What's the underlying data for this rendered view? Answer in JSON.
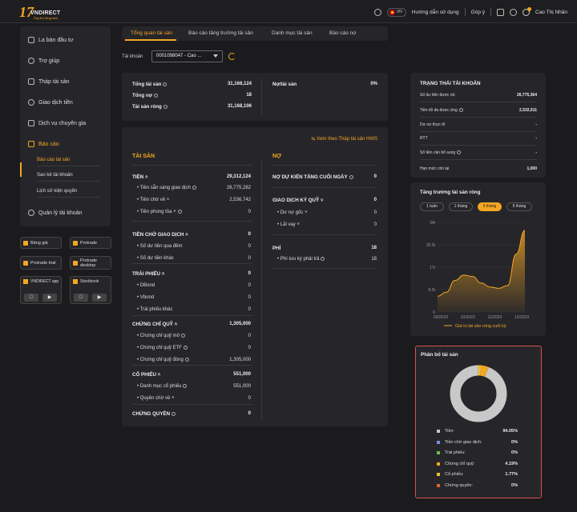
{
  "header": {
    "brand_mark": "17",
    "brand_name": "VNDIRECT",
    "brand_tag": "Ông thợ đồng hành",
    "lang": "VN",
    "help": "Hướng dẫn sử dụng",
    "feedback": "Góp ý",
    "user": "Cao Thị Nhân",
    "icons": [
      "gear-icon",
      "flag-icon",
      "mail-icon",
      "bell-icon",
      "user-icon"
    ]
  },
  "sidebar": {
    "items": [
      {
        "label": "La bàn đầu tư",
        "icon": "book-icon"
      },
      {
        "label": "Trợ giúp",
        "icon": "help-icon"
      },
      {
        "label": "Tháp tài sản",
        "icon": "pyramid-icon"
      },
      {
        "label": "Giao dịch tiền",
        "icon": "money-icon"
      },
      {
        "label": "Dịch vụ chuyên gia",
        "icon": "expert-icon"
      },
      {
        "label": "Báo cáo",
        "icon": "report-icon"
      }
    ],
    "sub_items": [
      "Báo cáo tài sản",
      "Sao kê tài khoản",
      "Lịch sử kiện quyền"
    ],
    "account_mgmt": "Quản lý tài khoản"
  },
  "apps": {
    "bang_gia": "Bảng giá",
    "protrade": "Protrade",
    "protrade_trial": "Protrade trial",
    "protrade_desktop": "Protrade desktop",
    "vndirect_app": "VNDIRECT app",
    "stockbook": "Stockbook"
  },
  "tabs": [
    "Tổng quan tài sản",
    "Báo cáo tăng trưởng tài sản",
    "Danh mục tài sản",
    "Báo cáo nợ"
  ],
  "account": {
    "label": "Tài khoản",
    "value": "0001098047 - Cao ..."
  },
  "summary": {
    "total_assets_label": "Tổng tài sản",
    "total_assets": "31,168,124",
    "total_debt_label": "Tổng nợ",
    "total_debt": "18",
    "net_assets_label": "Tài sản ròng",
    "net_assets": "31,168,106",
    "debt_ratio_label": "Nợ/tài sản",
    "debt_ratio": "0%"
  },
  "detail": {
    "link": "Xem theo Tháp tài sản HWS",
    "assets_header": "TÀI SẢN",
    "debt_header": "NỢ",
    "assets": [
      {
        "label": "TIỀN",
        "value": "29,312,124",
        "bold": true
      },
      {
        "label": "Tiền sẵn sàng giao dịch",
        "value": "26,775,282"
      },
      {
        "label": "Tiền chờ về",
        "value": "2,536,742"
      },
      {
        "label": "Tiền phong tỏa",
        "value": "0"
      },
      {
        "label": "TIỀN CHỜ GIAO DỊCH",
        "value": "0",
        "bold": true
      },
      {
        "label": "Số dư tiền qua đêm",
        "value": "0"
      },
      {
        "label": "Số dư tiền khác",
        "value": "0"
      },
      {
        "label": "TRÁI PHIẾU",
        "value": "0",
        "bold": true
      },
      {
        "label": "DBond",
        "value": "0"
      },
      {
        "label": "Vbond",
        "value": "0"
      },
      {
        "label": "Trái phiếu khác",
        "value": "0"
      },
      {
        "label": "CHỨNG CHỈ QUỸ",
        "value": "1,305,000",
        "bold": true
      },
      {
        "label": "Chứng chỉ quỹ mở",
        "value": "0"
      },
      {
        "label": "Chứng chỉ quỹ ETF",
        "value": "0"
      },
      {
        "label": "Chứng chỉ quỹ đóng",
        "value": "1,305,000"
      },
      {
        "label": "CỔ PHIẾU",
        "value": "551,000",
        "bold": true
      },
      {
        "label": "Danh mục cổ phiếu",
        "value": "551,000"
      },
      {
        "label": "Quyền chờ về",
        "value": "0"
      },
      {
        "label": "CHỨNG QUYỀN",
        "value": "0",
        "bold": true
      }
    ],
    "debts": [
      {
        "label": "NỢ DỰ KIẾN TẤNG CUỐI NGÀY",
        "value": "0",
        "bold": true
      },
      {
        "label": "GIAO DỊCH KÝ QUỸ",
        "value": "0",
        "bold": true
      },
      {
        "label": "Dư nợ gốc",
        "value": "0"
      },
      {
        "label": "Lãi vay",
        "value": "0"
      },
      {
        "label": "PHÍ",
        "value": "18",
        "bold": true
      },
      {
        "label": "Phí lưu ký phải trả",
        "value": "18"
      }
    ]
  },
  "account_status": {
    "title": "TRẠNG THÁI TÀI KHOẢN",
    "rows": [
      {
        "label": "Số dư tiền được rút",
        "value": "26,775,364"
      },
      {
        "label": "Tiền tối đa được ứng",
        "value": "2,532,911"
      },
      {
        "label": "Dư nợ thực tế",
        "value": "-"
      },
      {
        "label": "RTT",
        "value": "-"
      },
      {
        "label": "Số tiền cần bổ sung",
        "value": "-"
      },
      {
        "label": "Hạn mức còn lại",
        "value": "1,000"
      }
    ]
  },
  "growth": {
    "title": "Tăng trưởng tài sản ròng",
    "periods": [
      "1 tuần",
      "1 tháng",
      "3 tháng",
      "6 tháng"
    ],
    "active_period": "3 tháng",
    "legend": "Giá trị tài sản ròng cuối kỳ"
  },
  "chart_data": {
    "type": "area",
    "x": [
      "09/2023",
      "10/2023",
      "11/2023",
      "12/2023"
    ],
    "yticks": [
      "0",
      "8.5t",
      "17t",
      "25.5t",
      "34t"
    ],
    "ylim": [
      0,
      34
    ],
    "values": [
      6,
      7.5,
      12,
      14,
      13.5,
      11,
      9.5,
      9,
      10,
      22,
      31
    ],
    "legend": "Giá trị tài sản ròng cuối kỳ",
    "color": "#f5a623"
  },
  "allocation": {
    "title": "Phân bổ tài sản",
    "items": [
      {
        "label": "Tiền:",
        "value": "94.05%",
        "color": "#c8c8c8",
        "pct": 94.05
      },
      {
        "label": "Tiền chờ giao dịch:",
        "value": "0%",
        "color": "#7b8ce0",
        "pct": 0
      },
      {
        "label": "Trái phiếu:",
        "value": "0%",
        "color": "#6bbf4e",
        "pct": 0
      },
      {
        "label": "Chứng chỉ quỹ:",
        "value": "4.19%",
        "color": "#f5a623",
        "pct": 4.19
      },
      {
        "label": "Cổ phiếu:",
        "value": "1.77%",
        "color": "#e8c229",
        "pct": 1.77
      },
      {
        "label": "Chứng quyền:",
        "value": "0%",
        "color": "#e2622a",
        "pct": 0
      }
    ]
  }
}
